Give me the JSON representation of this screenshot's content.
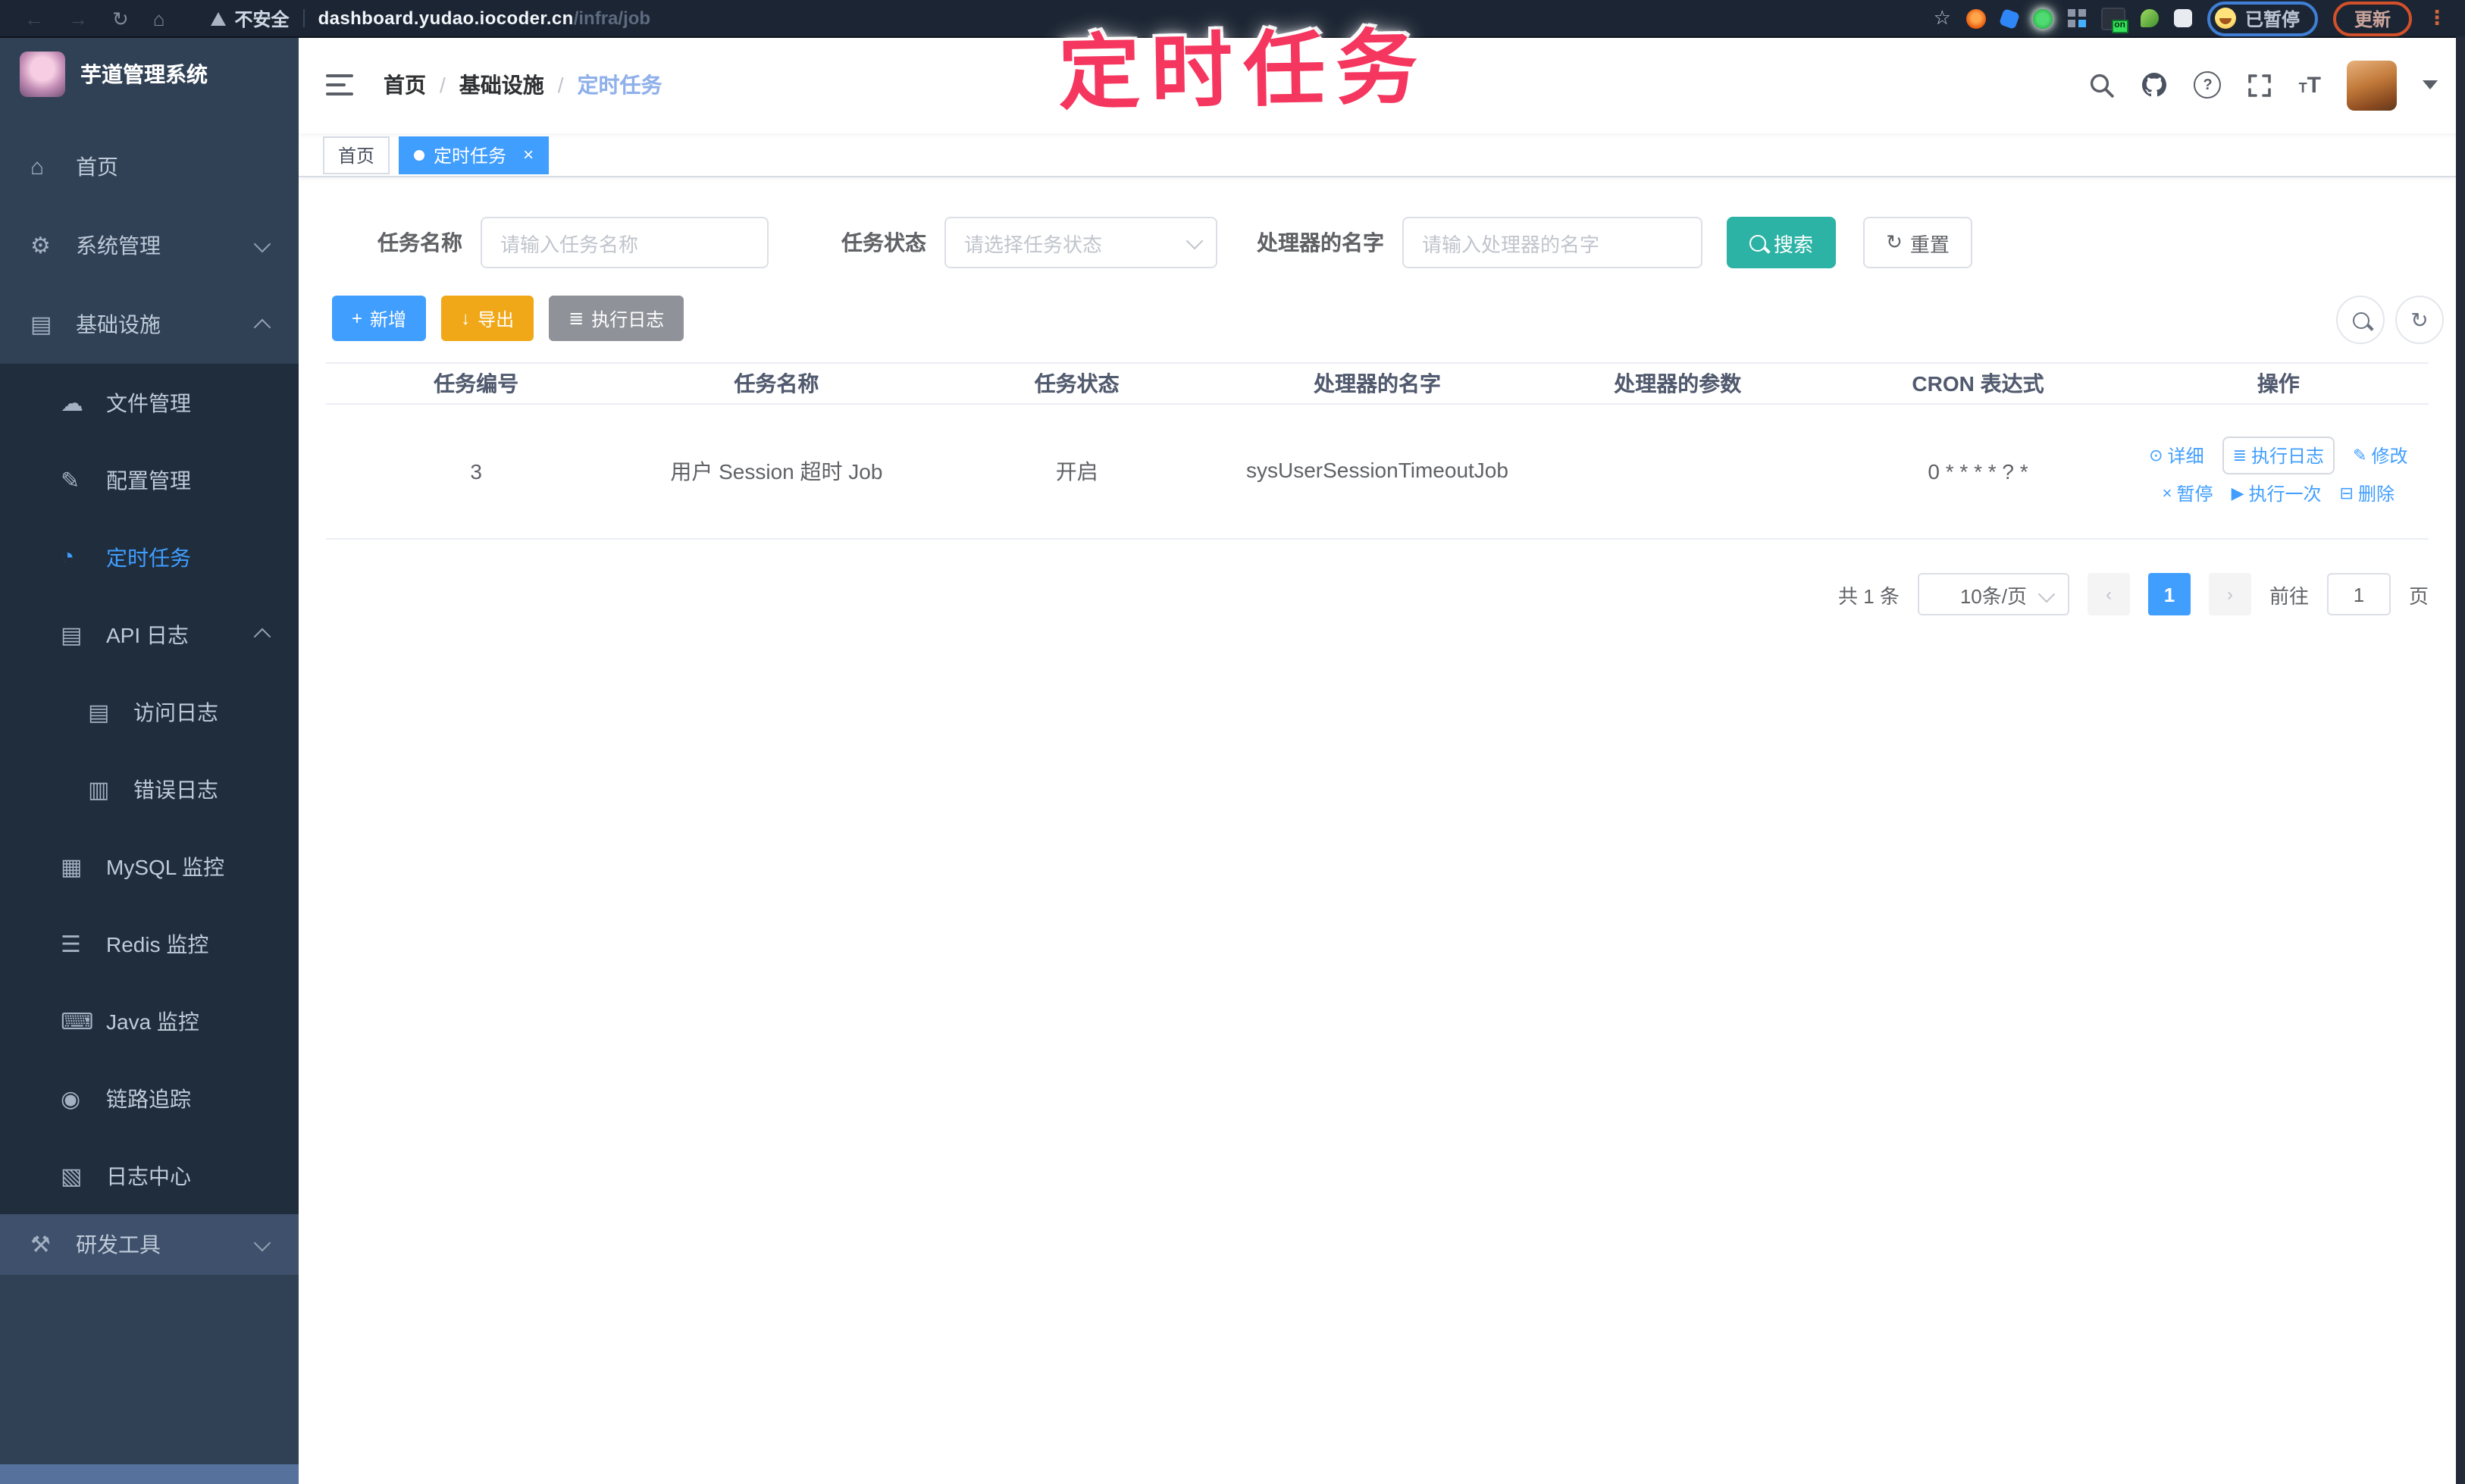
{
  "annotation": {
    "title": "定时任务"
  },
  "browser": {
    "security_label": "不安全",
    "url_host": "dashboard.yudao.iocoder.cn",
    "url_path": "/infra/job",
    "extension_badge": "on",
    "profile_status": "已暂停",
    "update_button": "更新"
  },
  "sidebar": {
    "app_title": "芋道管理系统",
    "items": [
      {
        "label": "首页"
      },
      {
        "label": "系统管理"
      },
      {
        "label": "基础设施"
      },
      {
        "label": "文件管理"
      },
      {
        "label": "配置管理"
      },
      {
        "label": "定时任务"
      },
      {
        "label": "API 日志"
      },
      {
        "label": "访问日志"
      },
      {
        "label": "错误日志"
      },
      {
        "label": "MySQL 监控"
      },
      {
        "label": "Redis 监控"
      },
      {
        "label": "Java 监控"
      },
      {
        "label": "链路追踪"
      },
      {
        "label": "日志中心"
      },
      {
        "label": "研发工具"
      }
    ]
  },
  "header": {
    "breadcrumb": [
      "首页",
      "基础设施",
      "定时任务"
    ],
    "separator": "/"
  },
  "tabs": [
    {
      "label": "首页"
    },
    {
      "label": "定时任务"
    }
  ],
  "filters": {
    "name_label": "任务名称",
    "name_placeholder": "请输入任务名称",
    "status_label": "任务状态",
    "status_placeholder": "请选择任务状态",
    "handler_label": "处理器的名字",
    "handler_placeholder": "请输入处理器的名字",
    "search_button": "搜索",
    "reset_button": "重置"
  },
  "toolbar": {
    "add_button": "新增",
    "export_button": "导出",
    "exec_log_button": "执行日志"
  },
  "table": {
    "columns": [
      "任务编号",
      "任务名称",
      "任务状态",
      "处理器的名字",
      "处理器的参数",
      "CRON 表达式",
      "操作"
    ],
    "rows": [
      {
        "id": "3",
        "name": "用户 Session 超时 Job",
        "status": "开启",
        "handler": "sysUserSessionTimeoutJob",
        "params": "",
        "cron": "0 * * * * ? *"
      }
    ]
  },
  "row_actions": {
    "detail": "详细",
    "exec_log": "执行日志",
    "edit": "修改",
    "pause": "暂停",
    "run_once": "执行一次",
    "delete": "删除"
  },
  "pagination": {
    "total": "共 1 条",
    "page_size": "10条/页",
    "current_page": "1",
    "goto_label": "前往",
    "goto_value": "1",
    "page_unit": "页"
  },
  "icons": {
    "nav_back": "←",
    "nav_forward": "→",
    "nav_reload": "↻",
    "nav_home": "⌂",
    "star": "☆",
    "kebab": "⋮",
    "sb_home": "⌂",
    "sb_system": "⚙",
    "sb_infra": "▤",
    "sb_file": "☁",
    "sb_config": "✎",
    "sb_job": "◔",
    "sb_api_log": "▤",
    "sb_access_log": "▤",
    "sb_error_log": "▥",
    "sb_mysql": "▦",
    "sb_redis": "☰",
    "sb_java": "⌨",
    "sb_trace": "◉",
    "sb_log_center": "▧",
    "sb_dev_tools": "⚒",
    "help": "?",
    "font_size": "T",
    "font_size_small": "T",
    "add": "+",
    "export": "↓",
    "exec_log": "≣",
    "detail": "⊙",
    "edit": "✎",
    "pause": "×",
    "run_once": "▶",
    "delete": "⊟",
    "tag_close": "×",
    "prev": "‹",
    "next": "›"
  },
  "colors": {
    "primary": "#409eff",
    "search_teal": "#2cb3a5",
    "export_amber": "#f0a818",
    "info_gray": "#8f9399",
    "sidebar_bg": "#304156",
    "submenu_bg": "#1f2d3d",
    "annotation_pink": "#f5365f"
  }
}
